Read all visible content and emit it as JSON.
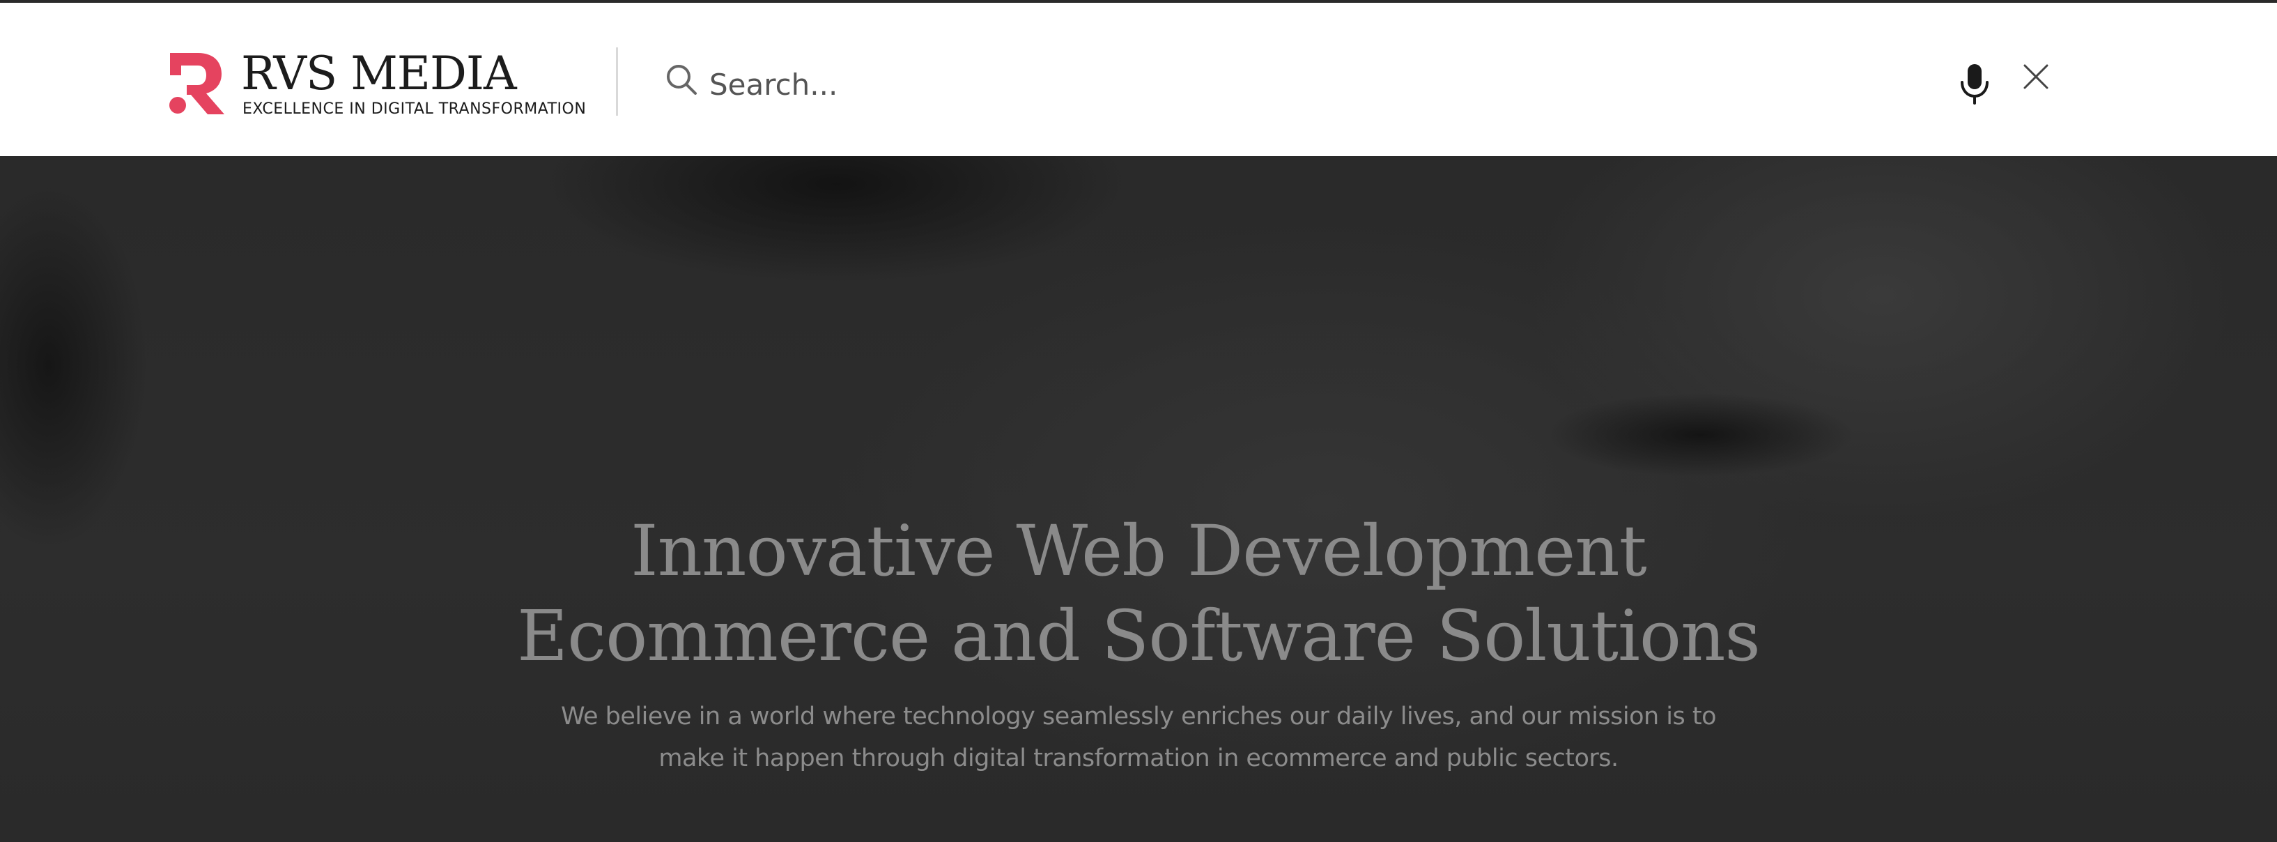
{
  "header": {
    "logo": {
      "name": "RVS MEDIA",
      "tagline": "EXCELLENCE IN DIGITAL TRANSFORMATION",
      "brand_color": "#e5435f"
    },
    "search": {
      "placeholder": "Search...",
      "value": "",
      "icon": "search-icon",
      "voice_icon": "microphone-icon",
      "close_icon": "close-icon"
    }
  },
  "hero": {
    "title_line1": "Innovative Web Development",
    "title_line2": "Ecommerce and Software Solutions",
    "subtitle_line1": "We believe in a world where technology seamlessly enriches our daily lives, and our mission is to",
    "subtitle_line2": "make it happen through digital transformation in ecommerce and public sectors."
  }
}
